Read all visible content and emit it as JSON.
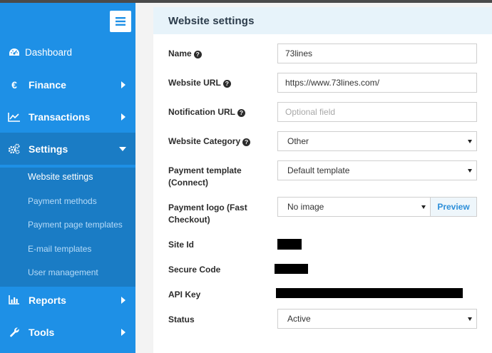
{
  "sidebar": {
    "items": [
      {
        "label": "Dashboard",
        "icon": "dashboard-gauge-icon"
      },
      {
        "label": "Finance",
        "icon": "euro-icon"
      },
      {
        "label": "Transactions",
        "icon": "line-chart-icon"
      },
      {
        "label": "Settings",
        "icon": "gears-icon"
      },
      {
        "label": "Reports",
        "icon": "bar-chart-icon"
      },
      {
        "label": "Tools",
        "icon": "wrench-icon"
      }
    ],
    "settings_submenu": [
      "Website settings",
      "Payment methods",
      "Payment page templates",
      "E-mail templates",
      "User management"
    ],
    "active_submenu": "Website settings",
    "colors": {
      "sidebar": "#1e90e6",
      "submenu": "#1a7cc5"
    }
  },
  "panel": {
    "title": "Website settings"
  },
  "form": {
    "name": {
      "label": "Name",
      "value": "73lines"
    },
    "website_url": {
      "label": "Website URL",
      "value": "https://www.73lines.com/"
    },
    "notification_url": {
      "label": "Notification URL",
      "value": "",
      "placeholder": "Optional field"
    },
    "website_category": {
      "label": "Website Category",
      "value": "Other"
    },
    "payment_template": {
      "label_line1": "Payment template",
      "label_line2": "(Connect)",
      "value": "Default template"
    },
    "payment_logo": {
      "label_line1": "Payment logo (Fast",
      "label_line2": "Checkout)",
      "value": "No image",
      "button": "Preview"
    },
    "site_id": {
      "label": "Site Id"
    },
    "secure_code": {
      "label": "Secure Code"
    },
    "api_key": {
      "label": "API Key"
    },
    "status": {
      "label": "Status",
      "value": "Active"
    }
  }
}
